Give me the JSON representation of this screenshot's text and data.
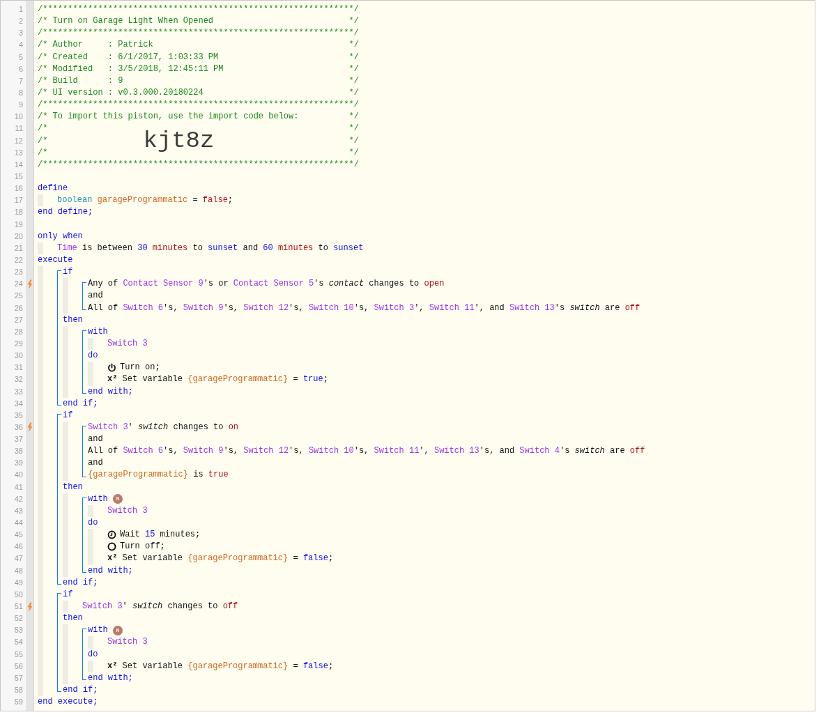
{
  "editor": {
    "lines": [
      {
        "kind": "line",
        "number": "1",
        "trigger": false,
        "tokens": [
          {
            "kind": "comment",
            "text": "/**************************************************************/"
          }
        ]
      },
      {
        "kind": "line",
        "number": "2",
        "trigger": false,
        "tokens": [
          {
            "kind": "comment",
            "text": "/* Turn on Garage Light When Opened"
          },
          {
            "kind": "comment_end",
            "text": "*/"
          }
        ]
      },
      {
        "kind": "line",
        "number": "3",
        "trigger": false,
        "tokens": [
          {
            "kind": "comment",
            "text": "/**************************************************************/"
          }
        ]
      },
      {
        "kind": "line",
        "number": "4",
        "trigger": false,
        "tokens": [
          {
            "kind": "comment",
            "text": "/* Author     : Patrick"
          },
          {
            "kind": "comment_end",
            "text": "*/"
          }
        ]
      },
      {
        "kind": "line",
        "number": "5",
        "trigger": false,
        "tokens": [
          {
            "kind": "comment",
            "text": "/* Created    : 6/1/2017, 1:03:33 PM"
          },
          {
            "kind": "comment_end",
            "text": "*/"
          }
        ]
      },
      {
        "kind": "line",
        "number": "6",
        "trigger": false,
        "tokens": [
          {
            "kind": "comment",
            "text": "/* Modified   : 3/5/2018, 12:45:11 PM"
          },
          {
            "kind": "comment_end",
            "text": "*/"
          }
        ]
      },
      {
        "kind": "line",
        "number": "7",
        "trigger": false,
        "tokens": [
          {
            "kind": "comment",
            "text": "/* Build      : 9"
          },
          {
            "kind": "comment_end",
            "text": "*/"
          }
        ]
      },
      {
        "kind": "line",
        "number": "8",
        "trigger": false,
        "tokens": [
          {
            "kind": "comment",
            "text": "/* UI version : v0.3.000.20180224"
          },
          {
            "kind": "comment_end",
            "text": "*/"
          }
        ]
      },
      {
        "kind": "line",
        "number": "9",
        "trigger": false,
        "tokens": [
          {
            "kind": "comment",
            "text": "/**************************************************************/"
          }
        ]
      },
      {
        "kind": "line",
        "number": "10",
        "trigger": false,
        "tokens": [
          {
            "kind": "comment",
            "text": "/* To import this piston, use the import code below:"
          },
          {
            "kind": "comment_end",
            "text": "*/"
          }
        ]
      },
      {
        "kind": "line",
        "number": "11",
        "trigger": false,
        "tokens": [
          {
            "kind": "comment",
            "text": "/*"
          },
          {
            "kind": "comment_end",
            "text": "*/"
          }
        ]
      },
      {
        "kind": "line",
        "number": "12",
        "trigger": false,
        "tokens": [
          {
            "kind": "comment",
            "text": "/*"
          },
          {
            "kind": "code",
            "text": "kjt8z"
          },
          {
            "kind": "comment_end",
            "text": "*/"
          }
        ]
      },
      {
        "kind": "line",
        "number": "13",
        "trigger": false,
        "tokens": [
          {
            "kind": "comment",
            "text": "/*"
          },
          {
            "kind": "comment_end",
            "text": "*/"
          }
        ]
      },
      {
        "kind": "line",
        "number": "14",
        "trigger": false,
        "tokens": [
          {
            "kind": "comment",
            "text": "/**************************************************************/"
          }
        ]
      },
      {
        "kind": "line",
        "number": "15",
        "trigger": false
      },
      {
        "kind": "line",
        "number": "16",
        "trigger": false,
        "tokens": [
          {
            "kind": "kw",
            "text": "define"
          }
        ],
        "children": [
          {
            "kind": "line",
            "number": "17",
            "trigger": false,
            "tokens": [
              {
                "kind": "type",
                "text": "boolean "
              },
              {
                "kind": "var",
                "text": "garageProgrammatic"
              },
              {
                "kind": "txt",
                "text": " = "
              },
              {
                "kind": "val",
                "text": "false"
              },
              {
                "kind": "txt",
                "text": ";"
              }
            ]
          }
        ]
      },
      {
        "kind": "line",
        "number": "18",
        "trigger": false,
        "tokens": [
          {
            "kind": "kw",
            "text": "end define;"
          }
        ]
      },
      {
        "kind": "line",
        "number": "19",
        "trigger": false
      },
      {
        "kind": "line",
        "number": "20",
        "trigger": false,
        "tokens": [
          {
            "kind": "kw",
            "text": "only when"
          }
        ],
        "children": [
          {
            "kind": "line",
            "number": "21",
            "trigger": false,
            "tokens": [
              {
                "kind": "dev",
                "text": "Time"
              },
              {
                "kind": "txt",
                "text": " is between "
              },
              {
                "kind": "num",
                "text": "30"
              },
              {
                "kind": "val",
                "text": " minutes"
              },
              {
                "kind": "txt",
                "text": " to "
              },
              {
                "kind": "kw",
                "text": "sunset"
              },
              {
                "kind": "txt",
                "text": " and "
              },
              {
                "kind": "num",
                "text": "60"
              },
              {
                "kind": "val",
                "text": " minutes"
              },
              {
                "kind": "txt",
                "text": " to "
              },
              {
                "kind": "kw",
                "text": "sunset"
              }
            ]
          }
        ]
      },
      {
        "kind": "line",
        "number": "22",
        "trigger": false,
        "tokens": [
          {
            "kind": "kw",
            "text": "execute"
          }
        ],
        "children": [
          {
            "kind": "block",
            "children": [
              {
                "kind": "line",
                "number": "23",
                "trigger": false,
                "tokens": [
                  {
                    "kind": "kw",
                    "text": "if"
                  }
                ],
                "children": [
                  {
                    "kind": "block",
                    "children": [
                      {
                        "kind": "line",
                        "number": "24",
                        "trigger": true,
                        "tokens": [
                          {
                            "kind": "txt",
                            "text": "Any of "
                          },
                          {
                            "kind": "dev",
                            "text": "Contact Sensor 9"
                          },
                          {
                            "kind": "txt",
                            "text": "'s or "
                          },
                          {
                            "kind": "dev",
                            "text": "Contact Sensor 5"
                          },
                          {
                            "kind": "txt",
                            "text": "'s "
                          },
                          {
                            "kind": "em",
                            "text": "contact"
                          },
                          {
                            "kind": "txt",
                            "text": " changes to "
                          },
                          {
                            "kind": "val",
                            "text": "open"
                          }
                        ]
                      },
                      {
                        "kind": "line",
                        "number": "25",
                        "trigger": false,
                        "tokens": [
                          {
                            "kind": "txt",
                            "text": "and"
                          }
                        ]
                      },
                      {
                        "kind": "line",
                        "number": "26",
                        "trigger": false,
                        "tokens": [
                          {
                            "kind": "txt",
                            "text": "All of "
                          },
                          {
                            "kind": "dev",
                            "text": "Switch 6"
                          },
                          {
                            "kind": "txt",
                            "text": "'s, "
                          },
                          {
                            "kind": "dev",
                            "text": "Switch 9"
                          },
                          {
                            "kind": "txt",
                            "text": "'s, "
                          },
                          {
                            "kind": "dev",
                            "text": "Switch 12"
                          },
                          {
                            "kind": "txt",
                            "text": "'s, "
                          },
                          {
                            "kind": "dev",
                            "text": "Switch 10"
                          },
                          {
                            "kind": "txt",
                            "text": "'s, "
                          },
                          {
                            "kind": "dev",
                            "text": "Switch 3"
                          },
                          {
                            "kind": "txt",
                            "text": "', "
                          },
                          {
                            "kind": "dev",
                            "text": "Switch 11"
                          },
                          {
                            "kind": "txt",
                            "text": "', and "
                          },
                          {
                            "kind": "dev",
                            "text": "Switch 13"
                          },
                          {
                            "kind": "txt",
                            "text": "'s "
                          },
                          {
                            "kind": "em",
                            "text": "switch"
                          },
                          {
                            "kind": "txt",
                            "text": " are "
                          },
                          {
                            "kind": "val",
                            "text": "off"
                          }
                        ]
                      }
                    ]
                  }
                ]
              },
              {
                "kind": "line",
                "number": "27",
                "trigger": false,
                "tokens": [
                  {
                    "kind": "kw",
                    "text": "then"
                  }
                ],
                "children": [
                  {
                    "kind": "block",
                    "children": [
                      {
                        "kind": "line",
                        "number": "28",
                        "trigger": false,
                        "tokens": [
                          {
                            "kind": "kw",
                            "text": "with"
                          }
                        ],
                        "children": [
                          {
                            "kind": "line",
                            "number": "29",
                            "trigger": false,
                            "tokens": [
                              {
                                "kind": "dev",
                                "text": "Switch 3"
                              }
                            ]
                          }
                        ]
                      },
                      {
                        "kind": "line",
                        "number": "30",
                        "trigger": false,
                        "tokens": [
                          {
                            "kind": "kw",
                            "text": "do"
                          }
                        ],
                        "children": [
                          {
                            "kind": "line",
                            "number": "31",
                            "trigger": false,
                            "tokens": [
                              {
                                "kind": "icon"
                              },
                              {
                                "kind": "txt",
                                "text": "Turn on;"
                              }
                            ]
                          },
                          {
                            "kind": "line",
                            "number": "32",
                            "trigger": false,
                            "tokens": [
                              {
                                "kind": "sym",
                                "text": "x²"
                              },
                              {
                                "kind": "txt",
                                "text": " Set variable "
                              },
                              {
                                "kind": "var",
                                "text": "{garageProgrammatic}"
                              },
                              {
                                "kind": "txt",
                                "text": " = "
                              },
                              {
                                "kind": "kw",
                                "text": "true"
                              },
                              {
                                "kind": "txt",
                                "text": ";"
                              }
                            ]
                          }
                        ]
                      },
                      {
                        "kind": "line",
                        "number": "33",
                        "trigger": false,
                        "tokens": [
                          {
                            "kind": "kw",
                            "text": "end with;"
                          }
                        ]
                      }
                    ]
                  }
                ]
              },
              {
                "kind": "line",
                "number": "34",
                "trigger": false,
                "tokens": [
                  {
                    "kind": "kw",
                    "text": "end if;"
                  }
                ]
              }
            ]
          },
          {
            "kind": "block",
            "children": [
              {
                "kind": "line",
                "number": "35",
                "trigger": false,
                "tokens": [
                  {
                    "kind": "kw",
                    "text": "if"
                  }
                ],
                "children": [
                  {
                    "kind": "block",
                    "children": [
                      {
                        "kind": "line",
                        "number": "36",
                        "trigger": true,
                        "tokens": [
                          {
                            "kind": "dev",
                            "text": "Switch 3"
                          },
                          {
                            "kind": "txt",
                            "text": "' "
                          },
                          {
                            "kind": "em",
                            "text": "switch"
                          },
                          {
                            "kind": "txt",
                            "text": " changes to "
                          },
                          {
                            "kind": "val",
                            "text": "on"
                          }
                        ]
                      },
                      {
                        "kind": "line",
                        "number": "37",
                        "trigger": false,
                        "tokens": [
                          {
                            "kind": "txt",
                            "text": "and"
                          }
                        ]
                      },
                      {
                        "kind": "line",
                        "number": "38",
                        "trigger": false,
                        "tokens": [
                          {
                            "kind": "txt",
                            "text": "All of "
                          },
                          {
                            "kind": "dev",
                            "text": "Switch 6"
                          },
                          {
                            "kind": "txt",
                            "text": "'s, "
                          },
                          {
                            "kind": "dev",
                            "text": "Switch 9"
                          },
                          {
                            "kind": "txt",
                            "text": "'s, "
                          },
                          {
                            "kind": "dev",
                            "text": "Switch 12"
                          },
                          {
                            "kind": "txt",
                            "text": "'s, "
                          },
                          {
                            "kind": "dev",
                            "text": "Switch 10"
                          },
                          {
                            "kind": "txt",
                            "text": "'s, "
                          },
                          {
                            "kind": "dev",
                            "text": "Switch 11"
                          },
                          {
                            "kind": "txt",
                            "text": "', "
                          },
                          {
                            "kind": "dev",
                            "text": "Switch 13"
                          },
                          {
                            "kind": "txt",
                            "text": "'s, and "
                          },
                          {
                            "kind": "dev",
                            "text": "Switch 4"
                          },
                          {
                            "kind": "txt",
                            "text": "'s "
                          },
                          {
                            "kind": "em",
                            "text": "switch"
                          },
                          {
                            "kind": "txt",
                            "text": " are "
                          },
                          {
                            "kind": "val",
                            "text": "off"
                          }
                        ]
                      },
                      {
                        "kind": "line",
                        "number": "39",
                        "trigger": false,
                        "tokens": [
                          {
                            "kind": "txt",
                            "text": "and"
                          }
                        ]
                      },
                      {
                        "kind": "line",
                        "number": "40",
                        "trigger": false,
                        "tokens": [
                          {
                            "kind": "var",
                            "text": "{garageProgrammatic}"
                          },
                          {
                            "kind": "txt",
                            "text": " is "
                          },
                          {
                            "kind": "val",
                            "text": "true"
                          }
                        ]
                      }
                    ]
                  }
                ]
              },
              {
                "kind": "line",
                "number": "41",
                "trigger": false,
                "tokens": [
                  {
                    "kind": "kw",
                    "text": "then"
                  }
                ],
                "children": [
                  {
                    "kind": "block",
                    "children": [
                      {
                        "kind": "line",
                        "number": "42",
                        "trigger": false,
                        "tokens": [
                          {
                            "kind": "kw",
                            "text": "with"
                          },
                          {
                            "kind": "badge",
                            "text": "N"
                          }
                        ],
                        "children": [
                          {
                            "kind": "line",
                            "number": "43",
                            "trigger": false,
                            "tokens": [
                              {
                                "kind": "dev",
                                "text": "Switch 3"
                              }
                            ]
                          }
                        ]
                      },
                      {
                        "kind": "line",
                        "number": "44",
                        "trigger": false,
                        "tokens": [
                          {
                            "kind": "kw",
                            "text": "do"
                          }
                        ],
                        "children": [
                          {
                            "kind": "line",
                            "number": "45",
                            "trigger": false,
                            "tokens": [
                              {
                                "kind": "icon"
                              },
                              {
                                "kind": "txt",
                                "text": "Wait "
                              },
                              {
                                "kind": "num",
                                "text": "15"
                              },
                              {
                                "kind": "txt",
                                "text": " minutes;"
                              }
                            ]
                          },
                          {
                            "kind": "line",
                            "number": "46",
                            "trigger": false,
                            "tokens": [
                              {
                                "kind": "icon"
                              },
                              {
                                "kind": "txt",
                                "text": "Turn off;"
                              }
                            ]
                          },
                          {
                            "kind": "line",
                            "number": "47",
                            "trigger": false,
                            "tokens": [
                              {
                                "kind": "sym",
                                "text": "x²"
                              },
                              {
                                "kind": "txt",
                                "text": " Set variable "
                              },
                              {
                                "kind": "var",
                                "text": "{garageProgrammatic}"
                              },
                              {
                                "kind": "txt",
                                "text": " = "
                              },
                              {
                                "kind": "kw",
                                "text": "false"
                              },
                              {
                                "kind": "txt",
                                "text": ";"
                              }
                            ]
                          }
                        ]
                      },
                      {
                        "kind": "line",
                        "number": "48",
                        "trigger": false,
                        "tokens": [
                          {
                            "kind": "kw",
                            "text": "end with;"
                          }
                        ]
                      }
                    ]
                  }
                ]
              },
              {
                "kind": "line",
                "number": "49",
                "trigger": false,
                "tokens": [
                  {
                    "kind": "kw",
                    "text": "end if;"
                  }
                ]
              }
            ]
          },
          {
            "kind": "block",
            "children": [
              {
                "kind": "line",
                "number": "50",
                "trigger": false,
                "tokens": [
                  {
                    "kind": "kw",
                    "text": "if"
                  }
                ],
                "children": [
                  {
                    "kind": "line",
                    "number": "51",
                    "trigger": true,
                    "tokens": [
                      {
                        "kind": "dev",
                        "text": "Switch 3"
                      },
                      {
                        "kind": "txt",
                        "text": "' "
                      },
                      {
                        "kind": "em",
                        "text": "switch"
                      },
                      {
                        "kind": "txt",
                        "text": " changes to "
                      },
                      {
                        "kind": "val",
                        "text": "off"
                      }
                    ]
                  }
                ]
              },
              {
                "kind": "line",
                "number": "52",
                "trigger": false,
                "tokens": [
                  {
                    "kind": "kw",
                    "text": "then"
                  }
                ],
                "children": [
                  {
                    "kind": "block",
                    "children": [
                      {
                        "kind": "line",
                        "number": "53",
                        "trigger": false,
                        "tokens": [
                          {
                            "kind": "kw",
                            "text": "with"
                          },
                          {
                            "kind": "badge",
                            "text": "N"
                          }
                        ],
                        "children": [
                          {
                            "kind": "line",
                            "number": "54",
                            "trigger": false,
                            "tokens": [
                              {
                                "kind": "dev",
                                "text": "Switch 3"
                              }
                            ]
                          }
                        ]
                      },
                      {
                        "kind": "line",
                        "number": "55",
                        "trigger": false,
                        "tokens": [
                          {
                            "kind": "kw",
                            "text": "do"
                          }
                        ],
                        "children": [
                          {
                            "kind": "line",
                            "number": "56",
                            "trigger": false,
                            "tokens": [
                              {
                                "kind": "sym",
                                "text": "x²"
                              },
                              {
                                "kind": "txt",
                                "text": " Set variable "
                              },
                              {
                                "kind": "var",
                                "text": "{garageProgrammatic}"
                              },
                              {
                                "kind": "txt",
                                "text": " = "
                              },
                              {
                                "kind": "kw",
                                "text": "false"
                              },
                              {
                                "kind": "txt",
                                "text": ";"
                              }
                            ]
                          }
                        ]
                      },
                      {
                        "kind": "line",
                        "number": "57",
                        "trigger": false,
                        "tokens": [
                          {
                            "kind": "kw",
                            "text": "end with;"
                          }
                        ]
                      }
                    ]
                  }
                ]
              },
              {
                "kind": "line",
                "number": "58",
                "trigger": false,
                "tokens": [
                  {
                    "kind": "kw",
                    "text": "end if;"
                  }
                ]
              }
            ]
          }
        ]
      },
      {
        "kind": "line",
        "number": "59",
        "trigger": false,
        "tokens": [
          {
            "kind": "kw",
            "text": "end execute;"
          }
        ]
      }
    ]
  }
}
